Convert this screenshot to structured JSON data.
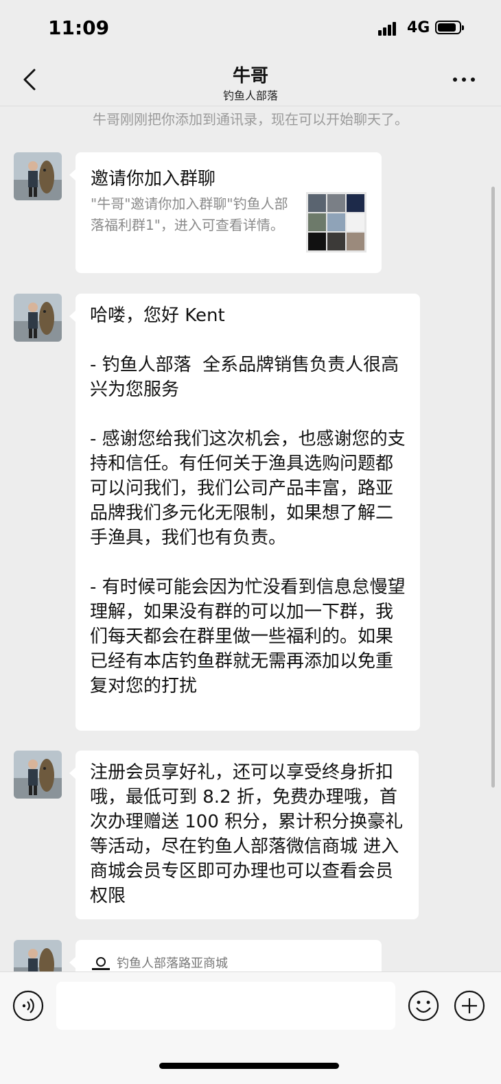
{
  "status_bar": {
    "time": "11:09",
    "network": "4G"
  },
  "nav": {
    "title": "牛哥",
    "subtitle": "钓鱼人部落",
    "back_icon": "chevron-left-icon",
    "more_icon": "more-dots-icon"
  },
  "system_message": "牛哥刚刚把你添加到通讯录，现在可以开始聊天了。",
  "messages": [
    {
      "type": "group-invite",
      "title": "邀请你加入群聊",
      "description": "\"牛哥\"邀请你加入群聊\"钓鱼人部落福利群1\"，进入可查看详情。"
    },
    {
      "type": "text",
      "text": "哈喽，您好 Kent\n\n- 钓鱼人部落  全系品牌销售负责人很高兴为您服务\n\n- 感谢您给我们这次机会，也感谢您的支持和信任。有任何关于渔具选购问题都可以问我们，我们公司产品丰富，路亚品牌我们多元化无限制，如果想了解二手渔具，我们也有负责。\n\n- 有时候可能会因为忙没看到信息怠慢望理解，如果没有群的可以加一下群，我们每天都会在群里做一些福利的。如果已经有本店钓鱼群就无需再添加以免重复对您的打扰"
    },
    {
      "type": "text",
      "text": "注册会员享好礼，还可以享受终身折扣哦，最低可到 8.2 折，免费办理哦，首次办理赠送 100 积分，累计积分换豪礼等活动，尽在钓鱼人部落微信商城 进入商城会员专区即可办理也可以查看会员权限"
    },
    {
      "type": "mini-program",
      "brand": "钓鱼人部落路亚商城"
    }
  ],
  "input_bar": {
    "placeholder": "",
    "voice_icon": "voice-icon",
    "emoji_icon": "emoji-icon",
    "plus_icon": "plus-icon"
  }
}
